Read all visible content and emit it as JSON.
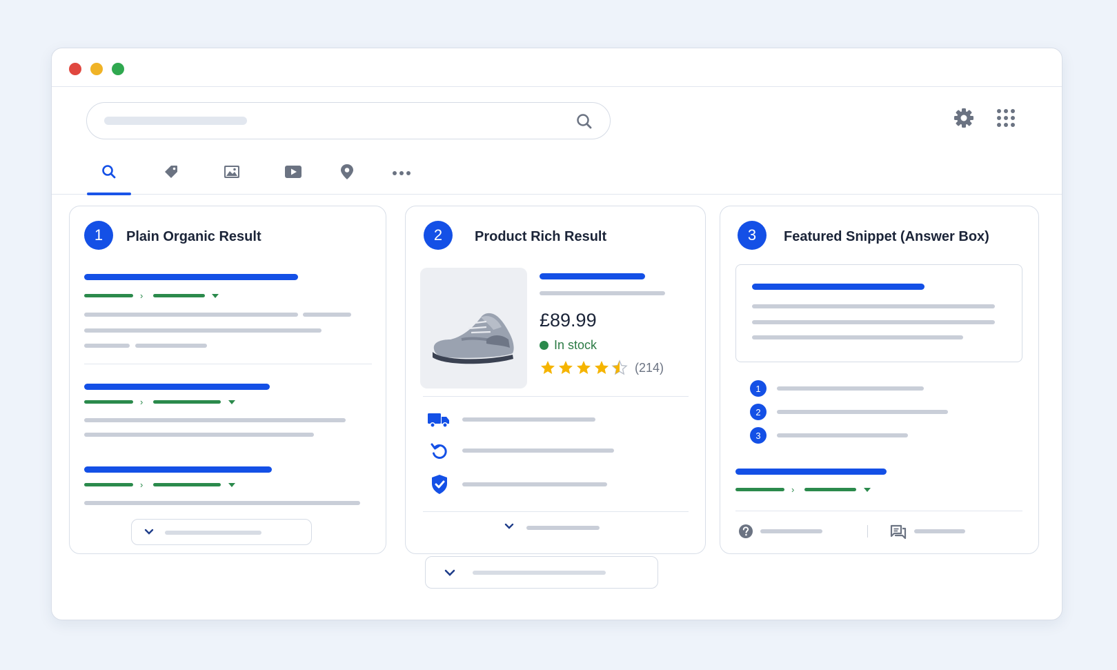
{
  "window": {
    "controls": [
      {
        "name": "close",
        "color": "#e0473f"
      },
      {
        "name": "minimize",
        "color": "#f0b326"
      },
      {
        "name": "maximize",
        "color": "#2fa84f"
      }
    ]
  },
  "header": {
    "icons": [
      "search-icon",
      "settings-icon",
      "apps-grid-icon"
    ]
  },
  "tabs": [
    {
      "name": "search",
      "icon": "search-icon",
      "active": true
    },
    {
      "name": "shopping",
      "icon": "tag-icon",
      "active": false
    },
    {
      "name": "images",
      "icon": "image-icon",
      "active": false
    },
    {
      "name": "videos",
      "icon": "video-icon",
      "active": false
    },
    {
      "name": "maps",
      "icon": "location-pin-icon",
      "active": false
    },
    {
      "name": "more",
      "icon": "more-dots-icon",
      "active": false
    }
  ],
  "cards": [
    {
      "number": "1",
      "title": "Plain Organic Result"
    },
    {
      "number": "2",
      "title": "Product Rich Result",
      "price": "£89.99",
      "stock": "In stock",
      "rating": 4.5,
      "reviews": "(214)",
      "features": [
        "truck-icon",
        "return-icon",
        "shield-icon"
      ]
    },
    {
      "number": "3",
      "title": "Featured Snippet (Answer Box)",
      "steps": [
        "1",
        "2",
        "3"
      ],
      "footer_icons": [
        "help-icon",
        "forum-icon"
      ]
    }
  ],
  "colors": {
    "accent": "#1450e6",
    "url_green": "#2b8a4c",
    "star": "#f5b400"
  }
}
